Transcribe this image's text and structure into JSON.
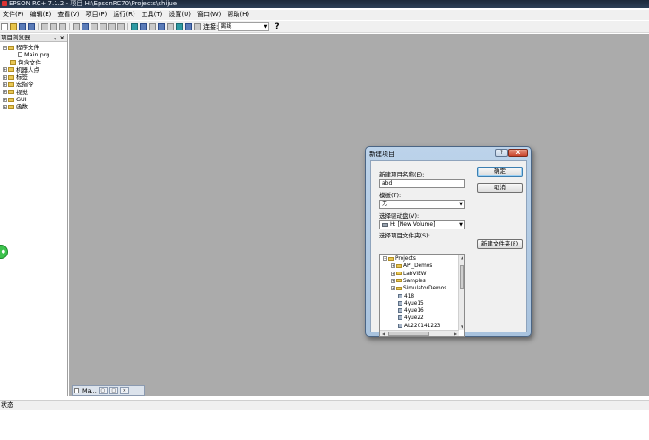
{
  "window": {
    "title": "EPSON RC+ 7.1.2 - 项目 H:\\EpsonRC70\\Projects\\shijue"
  },
  "menu": {
    "items": [
      "文件(F)",
      "编辑(E)",
      "查看(V)",
      "项目(P)",
      "运行(R)",
      "工具(T)",
      "设置(U)",
      "窗口(W)",
      "帮助(H)"
    ]
  },
  "toolbar": {
    "connection_label": "连接:",
    "connection_value": "离线",
    "help_glyph": "?"
  },
  "explorer": {
    "title": "项目浏览器",
    "pin_glyph": "ᵩ",
    "close_glyph": "×",
    "items": [
      {
        "label": "程序文件",
        "expander": "−"
      },
      {
        "label": "Main.prg"
      },
      {
        "label": "包含文件"
      },
      {
        "label": "机器人点",
        "expander": "+"
      },
      {
        "label": "标签",
        "expander": "+"
      },
      {
        "label": "宏指令",
        "expander": "+"
      },
      {
        "label": "视觉",
        "expander": "+"
      },
      {
        "label": "GUI",
        "expander": "+"
      },
      {
        "label": "函数",
        "expander": "+"
      }
    ]
  },
  "doc_tab": {
    "label": "Ma..."
  },
  "statusbar": {
    "text": "状态"
  },
  "dialog": {
    "title": "新建项目",
    "help_glyph": "?",
    "close_glyph": "X",
    "name_label": "新建项目名称(E):",
    "name_value": "abd",
    "template_label": "模板(T):",
    "template_value": "无",
    "drive_label": "选择驱动盘(V):",
    "drive_value": "H: [New Volume]",
    "folder_label": "选择项目文件夹(S):",
    "ok_label": "确定",
    "cancel_label": "取消",
    "new_folder_label": "新建文件夹(F)",
    "folders": [
      {
        "label": "Projects",
        "expander": "−",
        "kind": "folder"
      },
      {
        "label": "API_Demos",
        "expander": "+",
        "kind": "folder"
      },
      {
        "label": "LabVIEW",
        "expander": "+",
        "kind": "folder"
      },
      {
        "label": "Samples",
        "expander": "+",
        "kind": "folder"
      },
      {
        "label": "SimulatorDemos",
        "expander": "+",
        "kind": "folder"
      },
      {
        "label": "418",
        "kind": "project"
      },
      {
        "label": "4yue15",
        "kind": "project"
      },
      {
        "label": "4yue16",
        "kind": "project"
      },
      {
        "label": "4yue22",
        "kind": "project"
      },
      {
        "label": "AL220141223",
        "kind": "project"
      }
    ]
  }
}
